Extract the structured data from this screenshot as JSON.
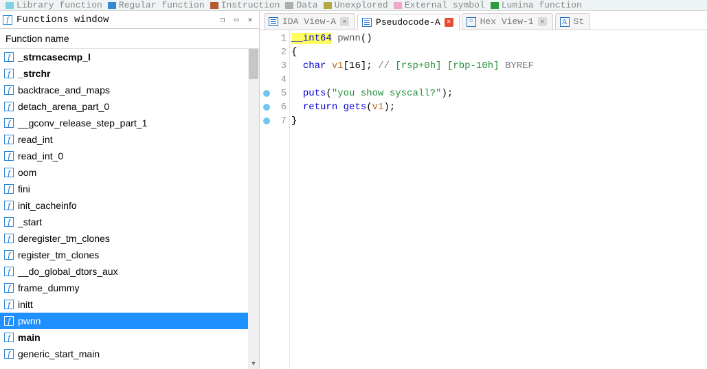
{
  "legend": [
    {
      "label": "Library function",
      "color": "#7fd0e0"
    },
    {
      "label": "Regular function",
      "color": "#3a86d6"
    },
    {
      "label": "Instruction",
      "color": "#b35a33"
    },
    {
      "label": "Data",
      "color": "#aeaeae"
    },
    {
      "label": "Unexplored",
      "color": "#b5a642"
    },
    {
      "label": "External symbol",
      "color": "#f2a6c8"
    },
    {
      "label": "Lumina function",
      "color": "#2d9b3e"
    }
  ],
  "functions_window": {
    "title": "Functions window",
    "column": "Function name",
    "items": [
      {
        "name": "_strncasecmp_l",
        "bold": true,
        "selected": false
      },
      {
        "name": "_strchr",
        "bold": true,
        "selected": false
      },
      {
        "name": "backtrace_and_maps",
        "bold": false,
        "selected": false
      },
      {
        "name": "detach_arena_part_0",
        "bold": false,
        "selected": false
      },
      {
        "name": "__gconv_release_step_part_1",
        "bold": false,
        "selected": false
      },
      {
        "name": "read_int",
        "bold": false,
        "selected": false
      },
      {
        "name": "read_int_0",
        "bold": false,
        "selected": false
      },
      {
        "name": "oom",
        "bold": false,
        "selected": false
      },
      {
        "name": "fini",
        "bold": false,
        "selected": false
      },
      {
        "name": "init_cacheinfo",
        "bold": false,
        "selected": false
      },
      {
        "name": "_start",
        "bold": false,
        "selected": false
      },
      {
        "name": "deregister_tm_clones",
        "bold": false,
        "selected": false
      },
      {
        "name": "register_tm_clones",
        "bold": false,
        "selected": false
      },
      {
        "name": "__do_global_dtors_aux",
        "bold": false,
        "selected": false
      },
      {
        "name": "frame_dummy",
        "bold": false,
        "selected": false
      },
      {
        "name": "initt",
        "bold": false,
        "selected": false
      },
      {
        "name": "pwnn",
        "bold": false,
        "selected": true
      },
      {
        "name": "main",
        "bold": true,
        "selected": false
      },
      {
        "name": "generic_start_main",
        "bold": false,
        "selected": false
      }
    ]
  },
  "tabs": [
    {
      "id": "ida-view-a",
      "label": "IDA View-A",
      "icon": "bars",
      "active": false,
      "close_style": "gray"
    },
    {
      "id": "pseudocode-a",
      "label": "Pseudocode-A",
      "icon": "bars",
      "active": true,
      "close_style": "red"
    },
    {
      "id": "hex-view-1",
      "label": "Hex View-1",
      "icon": "hex",
      "active": false,
      "close_style": "gray"
    },
    {
      "id": "st",
      "label": "St",
      "icon": "a",
      "active": false,
      "close_style": "none"
    }
  ],
  "code": {
    "lines": [
      {
        "n": 1,
        "bp": false,
        "first": true,
        "tokens": [
          [
            "type",
            "__int64"
          ],
          [
            "plain",
            " "
          ],
          [
            "funcname",
            "pwnn"
          ],
          [
            "plain",
            "()"
          ]
        ]
      },
      {
        "n": 2,
        "bp": false,
        "tokens": [
          [
            "plain",
            "{"
          ]
        ]
      },
      {
        "n": 3,
        "bp": false,
        "tokens": [
          [
            "plain",
            "  "
          ],
          [
            "type",
            "char"
          ],
          [
            "plain",
            " "
          ],
          [
            "var",
            "v1"
          ],
          [
            "plain",
            "["
          ],
          [
            "plain",
            "16"
          ],
          [
            "plain",
            "]; "
          ],
          [
            "comment",
            "// "
          ],
          [
            "annot",
            "[rsp+0h] [rbp-10h]"
          ],
          [
            "plain",
            " "
          ],
          [
            "byref",
            "BYREF"
          ]
        ]
      },
      {
        "n": 4,
        "bp": false,
        "tokens": [
          [
            "plain",
            ""
          ]
        ]
      },
      {
        "n": 5,
        "bp": true,
        "tokens": [
          [
            "plain",
            "  "
          ],
          [
            "func",
            "puts"
          ],
          [
            "plain",
            "("
          ],
          [
            "str",
            "\"you show syscall?\""
          ],
          [
            "plain",
            ");"
          ]
        ]
      },
      {
        "n": 6,
        "bp": true,
        "tokens": [
          [
            "plain",
            "  "
          ],
          [
            "kw",
            "return"
          ],
          [
            "plain",
            " "
          ],
          [
            "func",
            "gets"
          ],
          [
            "plain",
            "("
          ],
          [
            "var",
            "v1"
          ],
          [
            "plain",
            ");"
          ]
        ]
      },
      {
        "n": 7,
        "bp": true,
        "tokens": [
          [
            "plain",
            "}"
          ]
        ]
      }
    ]
  },
  "window_controls": {
    "undock": "❐",
    "restore": "▭",
    "close": "✕"
  }
}
